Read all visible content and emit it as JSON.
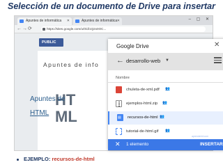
{
  "slide": {
    "title": "Selección de un documento de Drive para insertar",
    "bullet_label": "EJEMPLO: ",
    "bullet_value": "recursos-de-html"
  },
  "browser": {
    "tabs": [
      {
        "label": "Apuntes de informática"
      },
      {
        "label": "Apuntes de informática"
      }
    ],
    "url": "https://sites.google.com/u/0/d/1Q2x0OC...",
    "window_controls": "– ▢ ✕"
  },
  "site": {
    "publish_label": "PUBLIC",
    "site_name": "Apuntes de info",
    "big_text_1": "HT",
    "big_text_2": "ML",
    "subtitle_1": "Apuntes de",
    "subtitle_2": "HTML"
  },
  "drive_dialog": {
    "title": "Google Drive",
    "folder": "desarrollo-web",
    "column_header": "Nombre",
    "files": [
      {
        "name": "chuleta-de-xml.pdf",
        "type": "pdf",
        "shared": true
      },
      {
        "name": "ejemplos-html.zip",
        "type": "zip",
        "shared": true
      },
      {
        "name": "recursos-de-html",
        "type": "html",
        "shared": true,
        "selected": true
      },
      {
        "name": "tutorial-de-html.gif",
        "type": "gif",
        "shared": true
      }
    ],
    "selection_count": "1 elemento",
    "insert_label": "INSERTAR",
    "watermark": "aprendeinf.com"
  },
  "colors": {
    "title": "#1f3864",
    "selection_bar": "#3b78e7",
    "highlight": "#c0392b"
  }
}
